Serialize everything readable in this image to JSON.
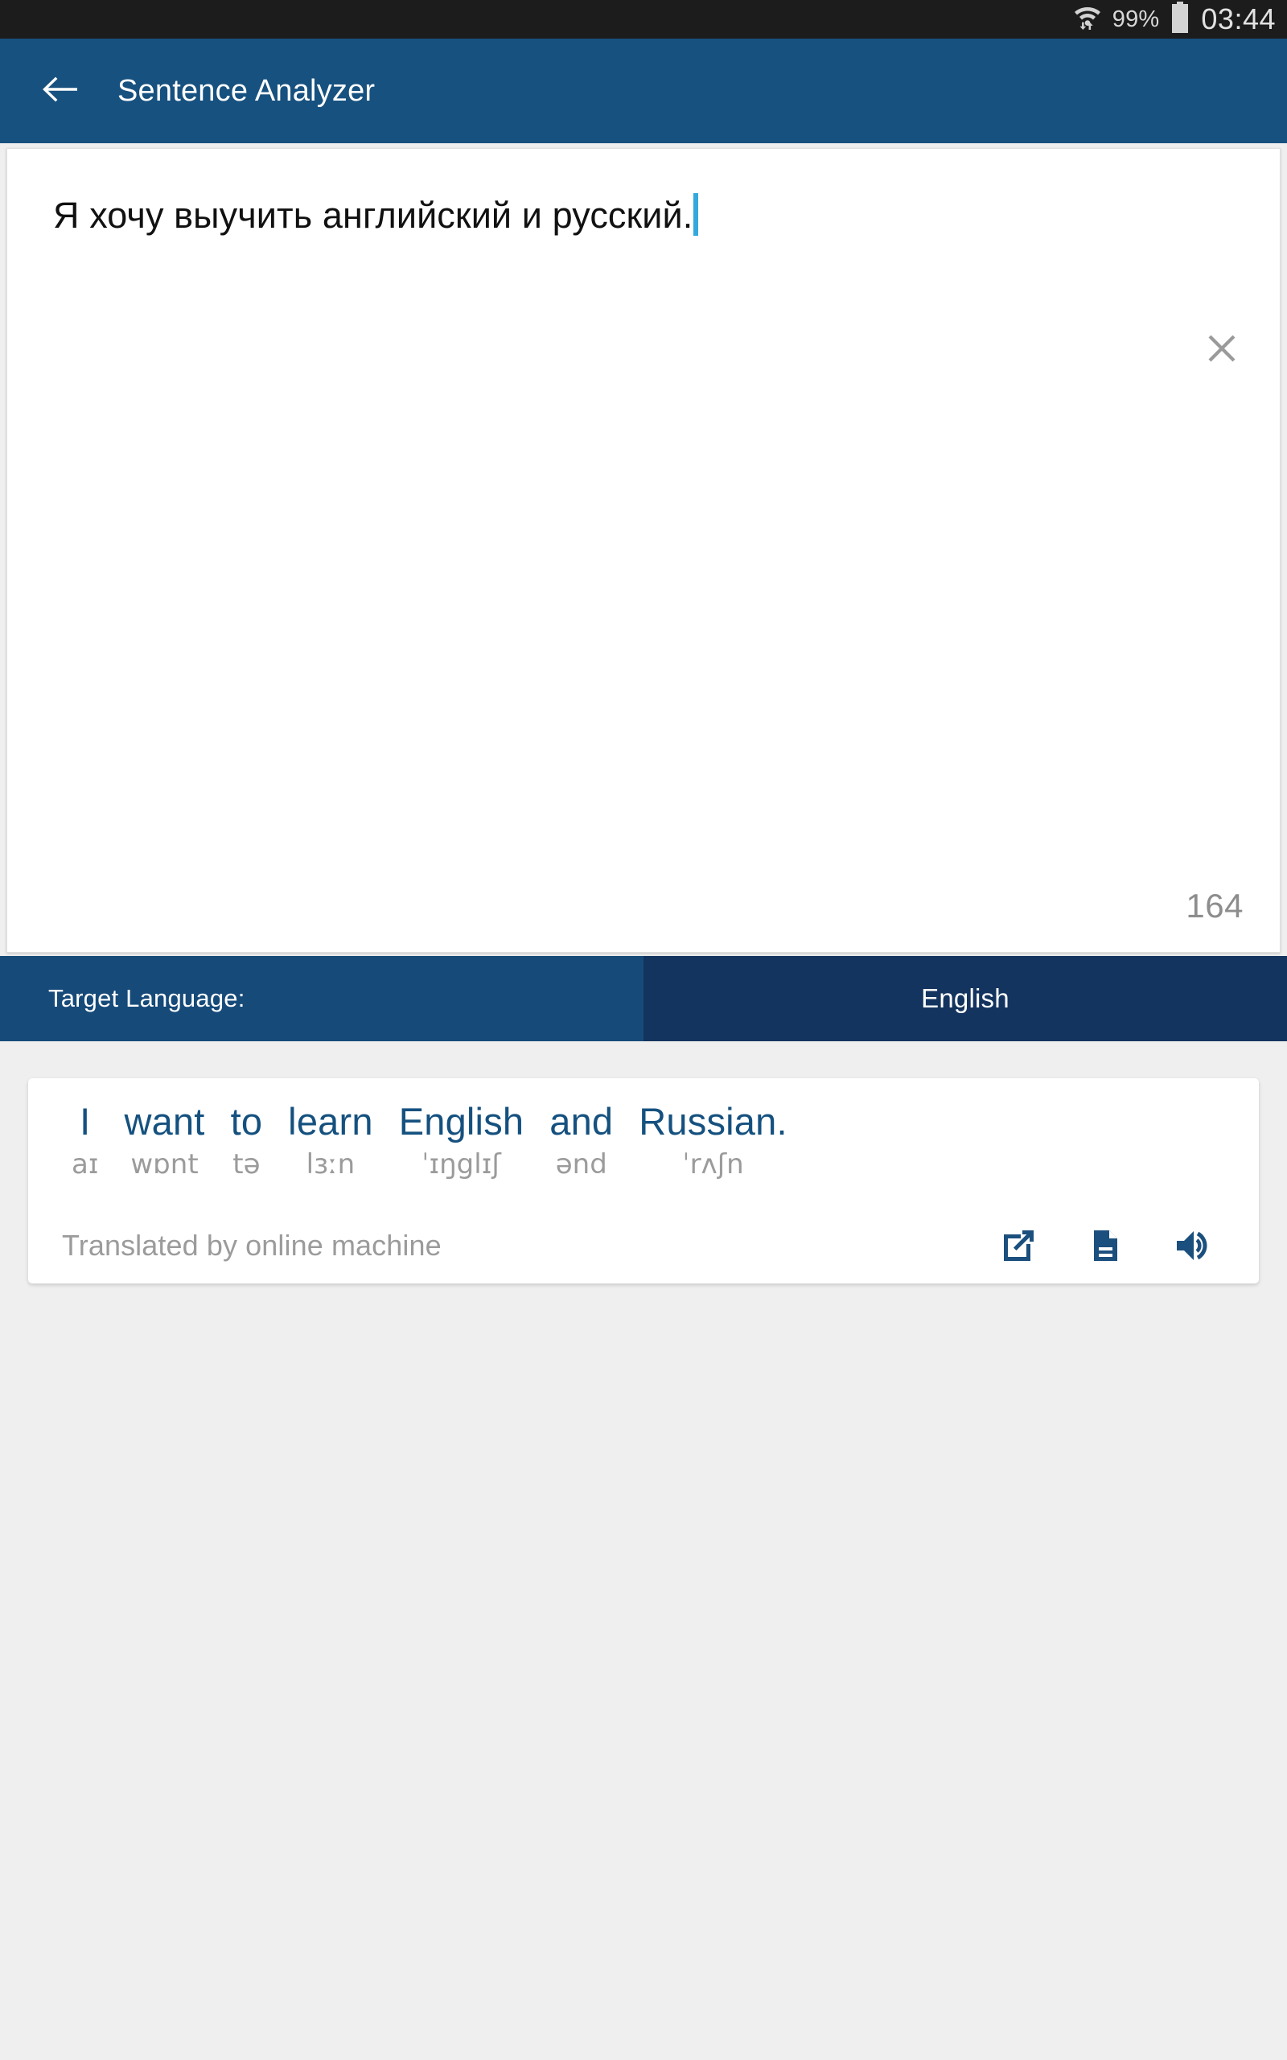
{
  "status_bar": {
    "wifi_icon": "wifi-icon",
    "battery_percent": "99%",
    "battery_icon": "battery-icon",
    "clock": "03:44"
  },
  "app_bar": {
    "back_icon": "back-arrow-icon",
    "title": "Sentence Analyzer"
  },
  "input": {
    "value": "Я хочу выучить английский и русский.",
    "clear_icon": "close-icon",
    "char_counter": "164"
  },
  "target_language": {
    "label": "Target Language:",
    "value": "English"
  },
  "result": {
    "words": [
      {
        "word": "I",
        "ipa": "aɪ"
      },
      {
        "word": "want",
        "ipa": "wɒnt"
      },
      {
        "word": "to",
        "ipa": "tə"
      },
      {
        "word": "learn",
        "ipa": "lɜːn"
      },
      {
        "word": "English",
        "ipa": "ˈɪŋglɪʃ"
      },
      {
        "word": "and",
        "ipa": "ənd"
      },
      {
        "word": "Russian.",
        "ipa": "ˈrʌʃn"
      }
    ],
    "source_note": "Translated by online machine",
    "actions": [
      {
        "name": "open-in-new-icon"
      },
      {
        "name": "document-icon"
      },
      {
        "name": "speaker-icon"
      }
    ]
  },
  "colors": {
    "app_bar": "#17517f",
    "target_label_bg": "#164a79",
    "target_value_bg": "#13345e",
    "accent_text": "#15517f",
    "muted_text": "#9b9b9b",
    "caret": "#35a8dd",
    "page_bg": "#efefef"
  }
}
